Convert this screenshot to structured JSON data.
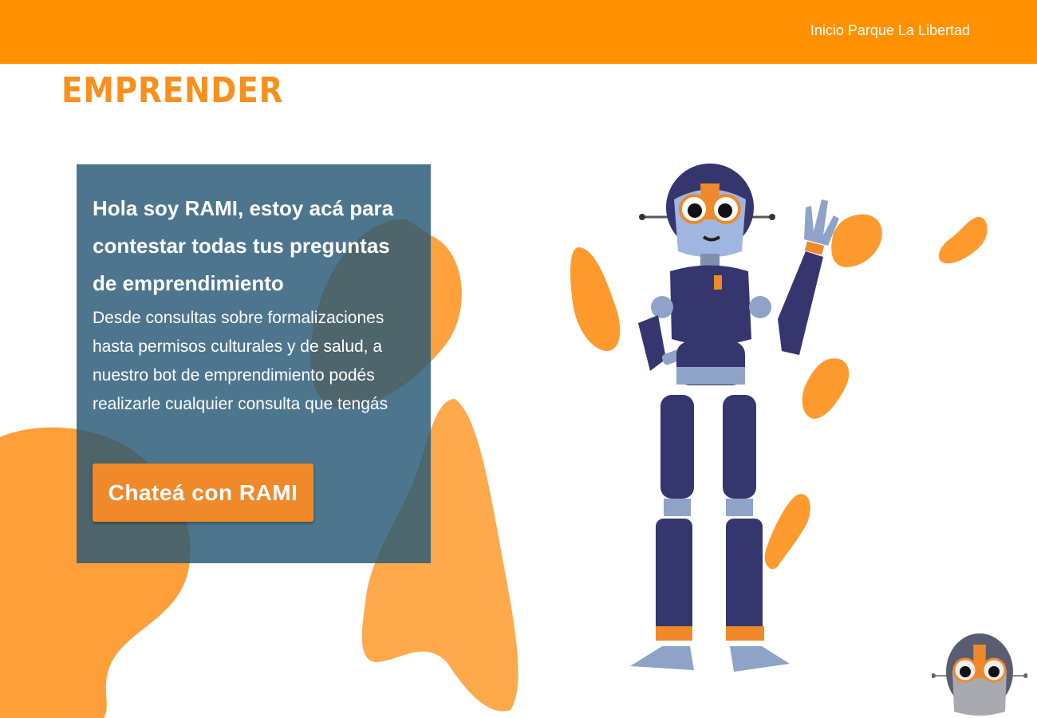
{
  "header": {
    "nav_link": "Inicio Parque La Libertad"
  },
  "page": {
    "title": "EMPRENDER"
  },
  "card": {
    "heading": "Hola soy RAMI, estoy acá para contestar todas tus preguntas de emprendimiento",
    "body": "Desde consultas sobre formalizaciones hasta permisos culturales y de salud, a nuestro bot de emprendimiento podés realizarle cualquier consulta que tengás",
    "cta_label": "Chateá con RAMI"
  },
  "colors": {
    "header_bg": "#ff9100",
    "title": "#f7901e",
    "card_bg": "#265875",
    "button": "#f0892a",
    "blob": "#ff9a2e",
    "robot_body": "#2f3068"
  },
  "icons": {
    "mascot": "robot-mascot-illustration",
    "launcher": "robot-head-chat-launcher"
  }
}
